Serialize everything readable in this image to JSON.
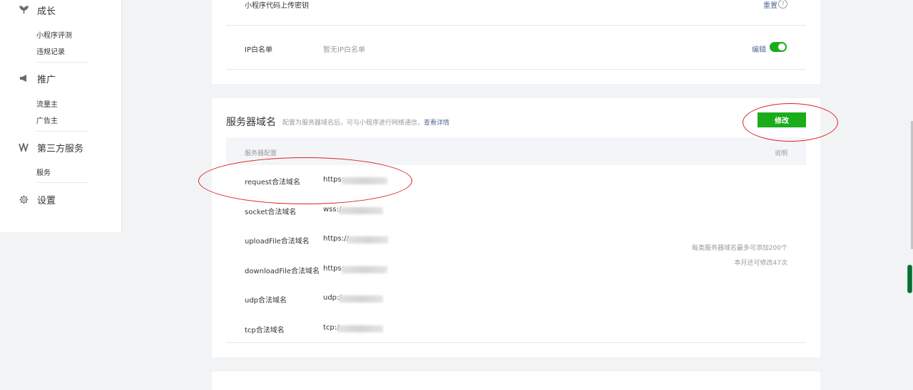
{
  "sidebar": {
    "groups": [
      {
        "head": "成长",
        "icon": "sprout-icon",
        "items": [
          "小程序评测",
          "违规记录"
        ]
      },
      {
        "head": "推广",
        "icon": "megaphone-icon",
        "items": [
          "流量主",
          "广告主"
        ]
      },
      {
        "head": "第三方服务",
        "icon": "third-party-icon",
        "items": [
          "服务"
        ]
      },
      {
        "head": "设置",
        "icon": "gear-icon",
        "items": []
      }
    ]
  },
  "dev_settings": {
    "secret_label": "小程序代码上传密钥",
    "reset_label": "重置",
    "help_glyph": "?",
    "ip_label": "IP白名单",
    "ip_value": "暂无IP白名单",
    "edit_label": "编辑"
  },
  "server_domain": {
    "title": "服务器域名",
    "desc": "配置为服务器域名后，可与小程序进行网络通信，",
    "desc_link": "查看详情",
    "modify_button": "修改",
    "col_config": "服务器配置",
    "col_desc": "说明",
    "rows": [
      {
        "name": "request合法域名",
        "value": "https:"
      },
      {
        "name": "socket合法域名",
        "value": "wss:/"
      },
      {
        "name": "uploadFile合法域名",
        "value": "https://"
      },
      {
        "name": "downloadFile合法域名",
        "value": "https:"
      },
      {
        "name": "udp合法域名",
        "value": "udp:/"
      },
      {
        "name": "tcp合法域名",
        "value": "tcp:/"
      }
    ],
    "note_limit": "每类服务器域名最多可添加200个",
    "note_remaining": "本月还可修改47次"
  },
  "colors": {
    "accent": "#1aad19",
    "link": "#576b95",
    "annotation": "#e02020"
  }
}
